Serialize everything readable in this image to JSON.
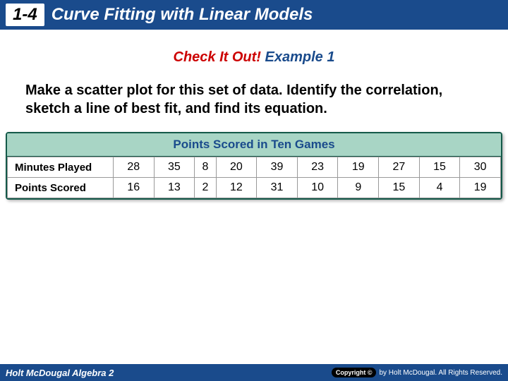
{
  "header": {
    "section": "1-4",
    "title": "Curve Fitting with Linear Models"
  },
  "example": {
    "check_label": "Check It Out!",
    "example_label": "Example 1"
  },
  "instructions": "Make a scatter plot for this set of data. Identify the correlation, sketch a line of best fit, and find its equation.",
  "table": {
    "title": "Points Scored in Ten Games",
    "rows": [
      {
        "label": "Minutes Played",
        "values": [
          "28",
          "35",
          "8",
          "20",
          "39",
          "23",
          "19",
          "27",
          "15",
          "30"
        ]
      },
      {
        "label": "Points Scored",
        "values": [
          "16",
          "13",
          "2",
          "12",
          "31",
          "10",
          "9",
          "15",
          "4",
          "19"
        ]
      }
    ]
  },
  "footer": {
    "left": "Holt McDougal Algebra 2",
    "copyright_badge": "Copyright ©",
    "copyright_text": "by Holt McDougal. All Rights Reserved."
  },
  "chart_data": {
    "type": "table",
    "title": "Points Scored in Ten Games",
    "categories": [
      "Minutes Played",
      "Points Scored"
    ],
    "series": [
      {
        "name": "Minutes Played",
        "values": [
          28,
          35,
          8,
          20,
          39,
          23,
          19,
          27,
          15,
          30
        ]
      },
      {
        "name": "Points Scored",
        "values": [
          16,
          13,
          2,
          12,
          31,
          10,
          9,
          15,
          4,
          19
        ]
      }
    ]
  }
}
